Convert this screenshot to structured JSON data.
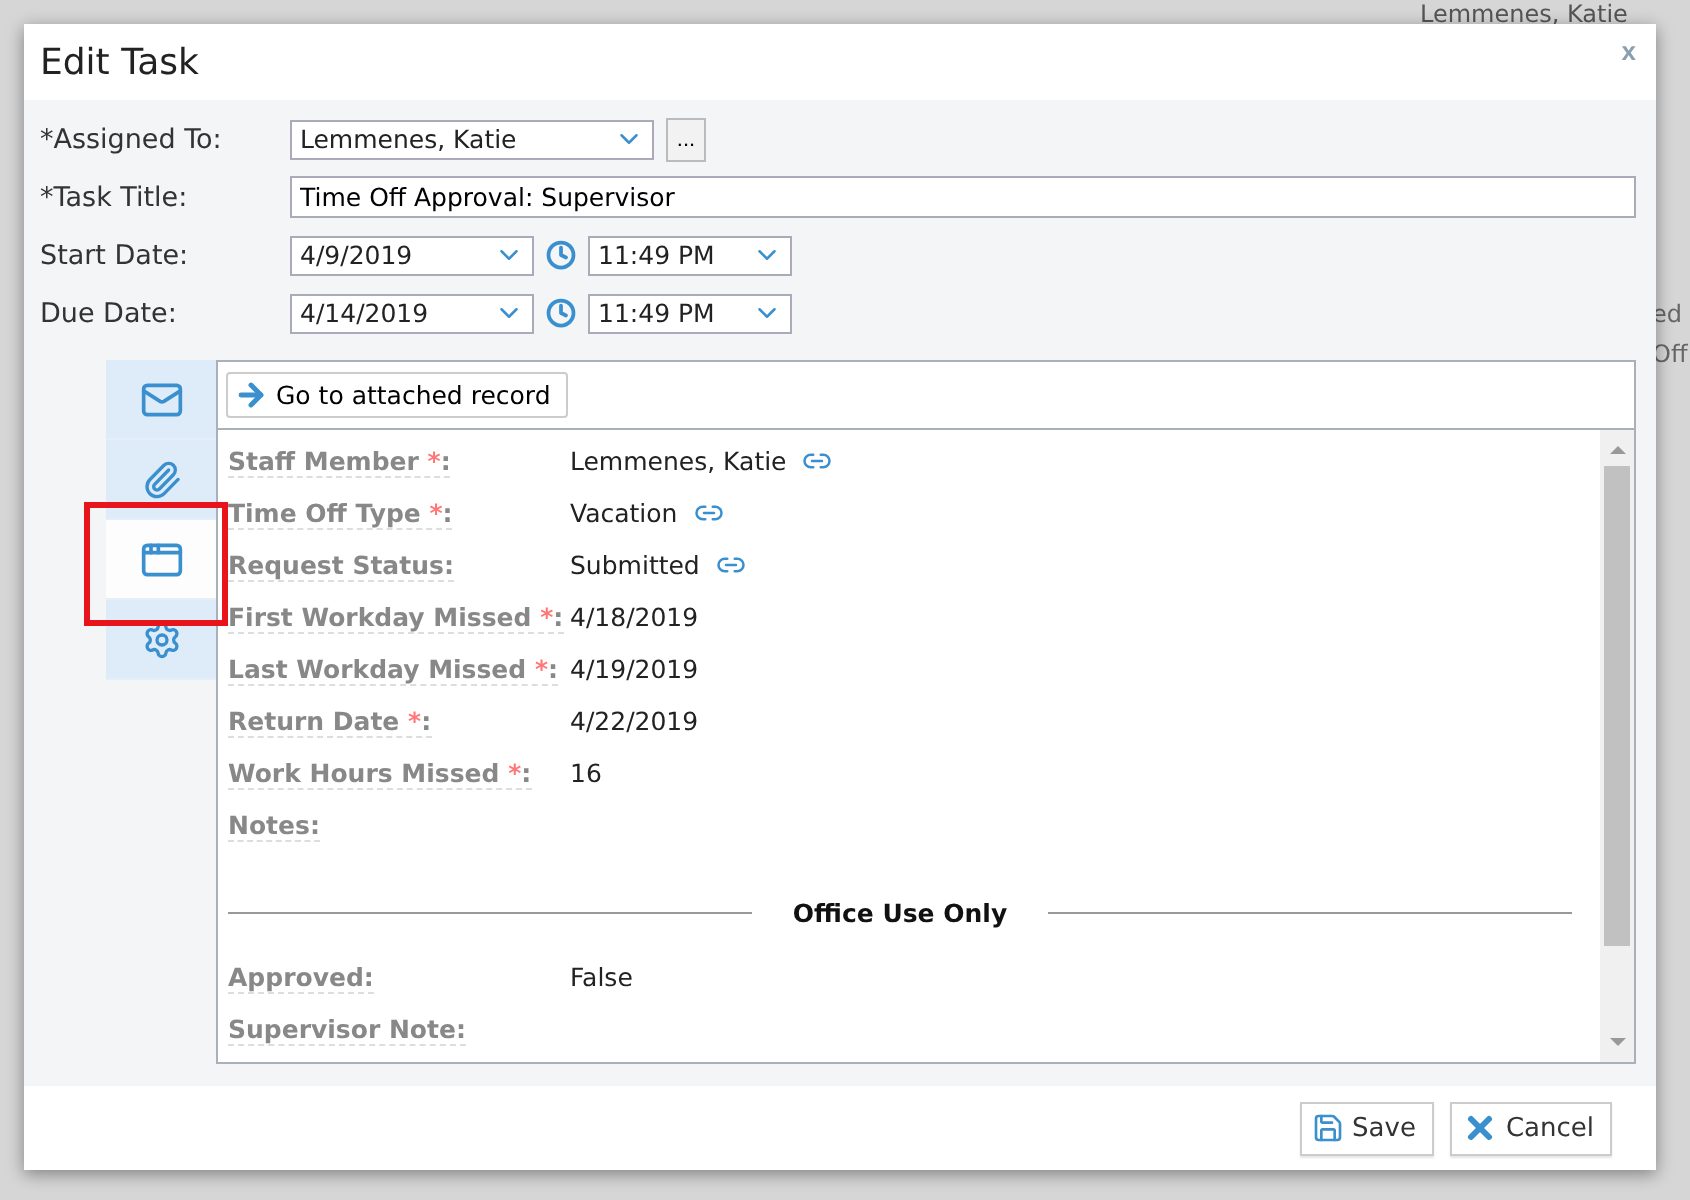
{
  "background": {
    "user_name": "Lemmenes, Katie",
    "fragments": [
      "ed",
      "Off"
    ]
  },
  "dialog": {
    "title": "Edit Task",
    "close": "x"
  },
  "form": {
    "assigned_to": {
      "label": "*Assigned To:",
      "value": "Lemmenes, Katie",
      "browse": "..."
    },
    "task_title": {
      "label": "*Task Title:",
      "value": "Time Off Approval: Supervisor"
    },
    "dates": [
      {
        "label": "Start Date:",
        "date": "4/9/2019",
        "time": "11:49 PM"
      },
      {
        "label": "Due Date:",
        "date": "4/14/2019",
        "time": "11:49 PM"
      }
    ]
  },
  "side_tabs": [
    {
      "kind": "email",
      "selected": false
    },
    {
      "kind": "attachment",
      "selected": false
    },
    {
      "kind": "record",
      "selected": true
    },
    {
      "kind": "settings",
      "selected": false
    }
  ],
  "record": {
    "go_button": "Go to attached record",
    "fields": [
      {
        "label": "Staff Member",
        "mark": "*",
        "colon": ":",
        "value": "Lemmenes, Katie",
        "linked": true
      },
      {
        "label": "Time Off Type",
        "mark": "*",
        "colon": ":",
        "value": "Vacation",
        "linked": true
      },
      {
        "label": "Request Status",
        "colon": ":",
        "value": "Submitted",
        "linked": true
      },
      {
        "label": "First Workday Missed",
        "mark": "*",
        "colon": ":",
        "value": "4/18/2019",
        "linked": false
      },
      {
        "label": "Last Workday Missed",
        "mark": "*",
        "colon": ":",
        "value": "4/19/2019",
        "linked": false
      },
      {
        "label": "Return Date",
        "mark": "*",
        "colon": ":",
        "value": "4/22/2019",
        "linked": false
      },
      {
        "label": "Work Hours Missed",
        "mark": "*",
        "colon": ":",
        "value": "16",
        "linked": false
      },
      {
        "label": "Notes",
        "colon": ":",
        "linked": false
      }
    ],
    "section": "Office Use Only",
    "office_fields": [
      {
        "label": "Approved",
        "colon": ":",
        "value": "False",
        "linked": false
      },
      {
        "label": "Supervisor Note",
        "colon": ":",
        "linked": false
      }
    ]
  },
  "buttons": [
    {
      "kind": "save",
      "label": "Save"
    },
    {
      "kind": "cancel",
      "label": "Cancel"
    }
  ]
}
